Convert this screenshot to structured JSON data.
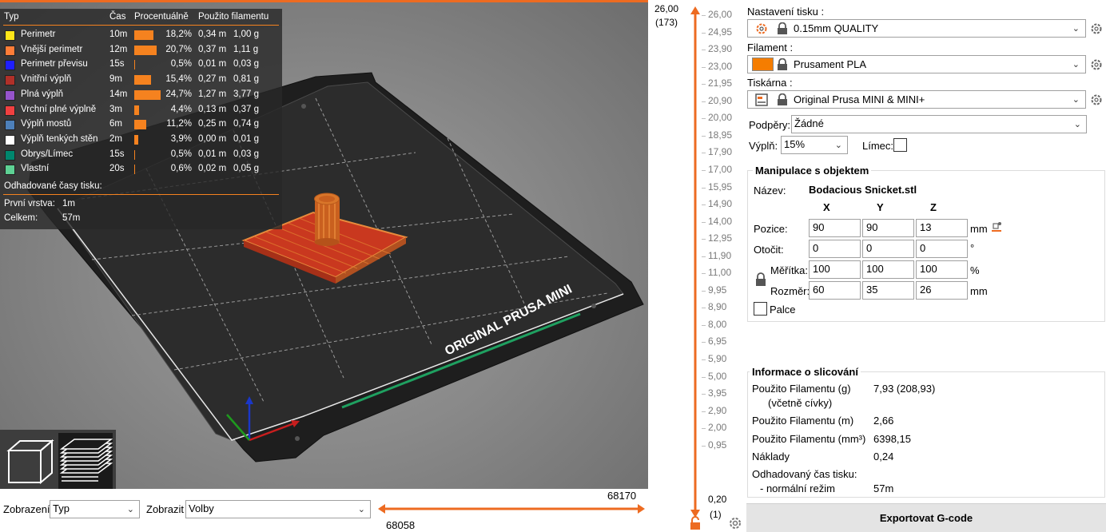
{
  "legend": {
    "headers": {
      "type": "Typ",
      "time": "Čas",
      "percent": "Procentuálně",
      "used": "Použito filamentu"
    },
    "rows": [
      {
        "name": "Perimetr",
        "time": "10m",
        "percent": "18,2%",
        "meters": "0,34 m",
        "grams": "1,00 g",
        "color": "#ffe619",
        "share": 0.182
      },
      {
        "name": "Vnější perimetr",
        "time": "12m",
        "percent": "20,7%",
        "meters": "0,37 m",
        "grams": "1,11 g",
        "color": "#ff7d38",
        "share": 0.207
      },
      {
        "name": "Perimetr převisu",
        "time": "15s",
        "percent": "0,5%",
        "meters": "0,01 m",
        "grams": "0,03 g",
        "color": "#1f1fff",
        "share": 0.005
      },
      {
        "name": "Vnitřní výplň",
        "time": "9m",
        "percent": "15,4%",
        "meters": "0,27 m",
        "grams": "0,81 g",
        "color": "#b03029",
        "share": 0.154
      },
      {
        "name": "Plná výplň",
        "time": "14m",
        "percent": "24,7%",
        "meters": "1,27 m",
        "grams": "3,77 g",
        "color": "#9654cc",
        "share": 0.247
      },
      {
        "name": "Vrchní plné výplně",
        "time": "3m",
        "percent": "4,4%",
        "meters": "0,13 m",
        "grams": "0,37 g",
        "color": "#f04040",
        "share": 0.044
      },
      {
        "name": "Výplň mostů",
        "time": "6m",
        "percent": "11,2%",
        "meters": "0,25 m",
        "grams": "0,74 g",
        "color": "#4d80ba",
        "share": 0.112
      },
      {
        "name": "Výplň tenkých stěn",
        "time": "2m",
        "percent": "3,9%",
        "meters": "0,00 m",
        "grams": "0,01 g",
        "color": "#ffffff",
        "share": 0.039
      },
      {
        "name": "Obrys/Límec",
        "time": "15s",
        "percent": "0,5%",
        "meters": "0,01 m",
        "grams": "0,03 g",
        "color": "#00876e",
        "share": 0.005
      },
      {
        "name": "Vlastní",
        "time": "20s",
        "percent": "0,6%",
        "meters": "0,02 m",
        "grams": "0,05 g",
        "color": "#5ed194",
        "share": 0.006
      }
    ],
    "estimated_title": "Odhadované časy tisku:",
    "first_layer_label": "První vrstva:",
    "first_layer_value": "1m",
    "total_label": "Celkem:",
    "total_value": "57m"
  },
  "bed_label": "ORIGINAL PRUSA MINI",
  "bottom": {
    "view_label": "Zobrazení",
    "view_value": "Typ",
    "show_label": "Zobrazit",
    "show_value": "Volby",
    "hslider_top": "68170",
    "hslider_bottom": "68058"
  },
  "vslider": {
    "top_value": "26,00",
    "top_layer": "(173)",
    "bottom_value": "0,20",
    "bottom_layer": "(1)",
    "ticks": [
      "26,00",
      "24,95",
      "23,90",
      "23,00",
      "21,95",
      "20,90",
      "20,00",
      "18,95",
      "17,90",
      "17,00",
      "15,95",
      "14,90",
      "14,00",
      "12,95",
      "11,90",
      "11,00",
      "9,95",
      "8,90",
      "8,00",
      "6,95",
      "5,90",
      "5,00",
      "3,95",
      "2,90",
      "2,00",
      "0,95"
    ]
  },
  "panel": {
    "print_settings_label": "Nastavení tisku :",
    "print_settings_value": "0.15mm QUALITY",
    "filament_label": "Filament :",
    "filament_value": "Prusament PLA",
    "filament_color": "#f57d00",
    "printer_label": "Tiskárna :",
    "printer_value": "Original Prusa MINI & MINI+",
    "supports_label": "Podpěry:",
    "supports_value": "Žádné",
    "infill_label": "Výplň:",
    "infill_value": "15%",
    "brim_label": "Límec:",
    "manip_title": "Manipulace s objektem",
    "name_label": "Název:",
    "name_value": "Bodacious Snicket.stl",
    "axes": [
      "X",
      "Y",
      "Z"
    ],
    "position_label": "Pozice:",
    "position": [
      "90",
      "90",
      "13"
    ],
    "position_unit": "mm",
    "rotation_label": "Otočit:",
    "rotation": [
      "0",
      "0",
      "0"
    ],
    "rotation_unit": "°",
    "scale_label": "Měřítka:",
    "scale": [
      "100",
      "100",
      "100"
    ],
    "scale_unit": "%",
    "size_label": "Rozměr:",
    "size": [
      "60",
      "35",
      "26"
    ],
    "size_unit": "mm",
    "inches_label": "Palce",
    "slice_title": "Informace o slicování",
    "used_g_label": "Použito Filamentu (g)",
    "used_g_sub": "(včetně cívky)",
    "used_g_value": "7,93 (208,93)",
    "used_m_label": "Použito Filamentu (m)",
    "used_m_value": "2,66",
    "used_mm3_label": "Použito Filamentu (mm³)",
    "used_mm3_value": "6398,15",
    "cost_label": "Náklady",
    "cost_value": "0,24",
    "est_time_label": "Odhadovaný čas tisku:",
    "normal_mode_label": "- normální režim",
    "normal_mode_value": "57m",
    "export_label": "Exportovat G-code"
  },
  "colors": {
    "accent": "#ed6b21",
    "bar": "#f5821f"
  }
}
